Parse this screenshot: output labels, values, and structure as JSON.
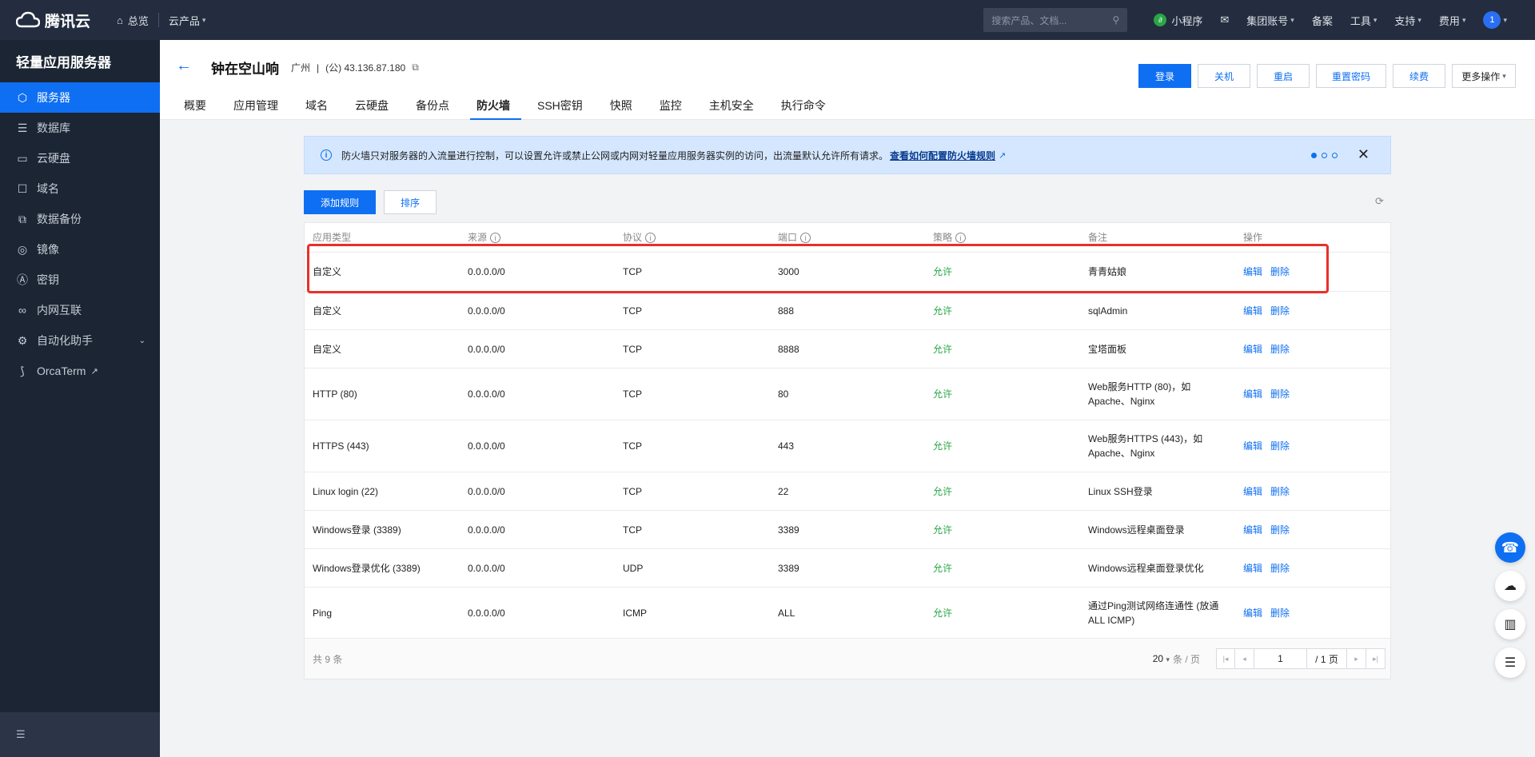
{
  "topbar": {
    "brand": "腾讯云",
    "overview": "总览",
    "products": "云产品",
    "search_placeholder": "搜索产品、文档...",
    "right_items": [
      {
        "label": "小程序",
        "icon": "miniprogram-icon"
      },
      {
        "label": "",
        "icon": "mail-icon"
      },
      {
        "label": "集团账号",
        "caret": true
      },
      {
        "label": "备案"
      },
      {
        "label": "工具",
        "caret": true
      },
      {
        "label": "支持",
        "caret": true
      },
      {
        "label": "费用",
        "caret": true
      }
    ],
    "avatar": "1"
  },
  "sidebar": {
    "title": "轻量应用服务器",
    "items": [
      {
        "label": "服务器",
        "icon": "cube-icon",
        "active": true
      },
      {
        "label": "数据库",
        "icon": "database-icon"
      },
      {
        "label": "云硬盘",
        "icon": "disk-icon"
      },
      {
        "label": "域名",
        "icon": "domain-icon"
      },
      {
        "label": "数据备份",
        "icon": "backup-icon"
      },
      {
        "label": "镜像",
        "icon": "image-icon"
      },
      {
        "label": "密钥",
        "icon": "key-icon"
      },
      {
        "label": "内网互联",
        "icon": "link-icon"
      },
      {
        "label": "自动化助手",
        "icon": "robot-icon",
        "expand": true
      },
      {
        "label": "OrcaTerm",
        "icon": "terminal-icon",
        "external": true
      }
    ]
  },
  "header": {
    "name": "钟在空山响",
    "region": "广州",
    "ip": "(公) 43.136.87.180",
    "buttons": [
      {
        "label": "登录",
        "primary": true
      },
      {
        "label": "关机"
      },
      {
        "label": "重启"
      },
      {
        "label": "重置密码"
      },
      {
        "label": "续费"
      },
      {
        "label": "更多操作",
        "dropdown": true
      }
    ],
    "tabs": [
      "概要",
      "应用管理",
      "域名",
      "云硬盘",
      "备份点",
      "防火墙",
      "SSH密钥",
      "快照",
      "监控",
      "主机安全",
      "执行命令"
    ],
    "active_tab": "防火墙"
  },
  "notice": {
    "text": "防火墙只对服务器的入流量进行控制，可以设置允许或禁止公网或内网对轻量应用服务器实例的访问，出流量默认允许所有请求。",
    "link": "查看如何配置防火墙规则"
  },
  "actions": {
    "add": "添加规则",
    "sort": "排序"
  },
  "table": {
    "columns": [
      "应用类型",
      "来源",
      "协议",
      "端口",
      "策略",
      "备注",
      "操作"
    ],
    "rows": [
      {
        "type": "自定义",
        "source": "0.0.0.0/0",
        "protocol": "TCP",
        "port": "3000",
        "policy": "允许",
        "note": "青青姑娘"
      },
      {
        "type": "自定义",
        "source": "0.0.0.0/0",
        "protocol": "TCP",
        "port": "888",
        "policy": "允许",
        "note": "sqlAdmin"
      },
      {
        "type": "自定义",
        "source": "0.0.0.0/0",
        "protocol": "TCP",
        "port": "8888",
        "policy": "允许",
        "note": "宝塔面板"
      },
      {
        "type": "HTTP (80)",
        "source": "0.0.0.0/0",
        "protocol": "TCP",
        "port": "80",
        "policy": "允许",
        "note": "Web服务HTTP (80)，如Apache、Nginx"
      },
      {
        "type": "HTTPS (443)",
        "source": "0.0.0.0/0",
        "protocol": "TCP",
        "port": "443",
        "policy": "允许",
        "note": "Web服务HTTPS (443)，如Apache、Nginx"
      },
      {
        "type": "Linux login (22)",
        "source": "0.0.0.0/0",
        "protocol": "TCP",
        "port": "22",
        "policy": "允许",
        "note": "Linux SSH登录"
      },
      {
        "type": "Windows登录 (3389)",
        "source": "0.0.0.0/0",
        "protocol": "TCP",
        "port": "3389",
        "policy": "允许",
        "note": "Windows远程桌面登录"
      },
      {
        "type": "Windows登录优化 (3389)",
        "source": "0.0.0.0/0",
        "protocol": "UDP",
        "port": "3389",
        "policy": "允许",
        "note": "Windows远程桌面登录优化"
      },
      {
        "type": "Ping",
        "source": "0.0.0.0/0",
        "protocol": "ICMP",
        "port": "ALL",
        "policy": "允许",
        "note": "通过Ping测试网络连通性 (放通ALL ICMP)"
      }
    ],
    "op_edit": "编辑",
    "op_delete": "删除",
    "total": "共 9 条",
    "page_size": "20",
    "per_page": "条 / 页",
    "page": "1",
    "pages": "/ 1 页"
  },
  "colors": {
    "accent": "#0e6ff2",
    "topbar": "#232d3f",
    "sidebar": "#1b2533",
    "allow": "#29a745",
    "highlight": "#e8302a"
  }
}
